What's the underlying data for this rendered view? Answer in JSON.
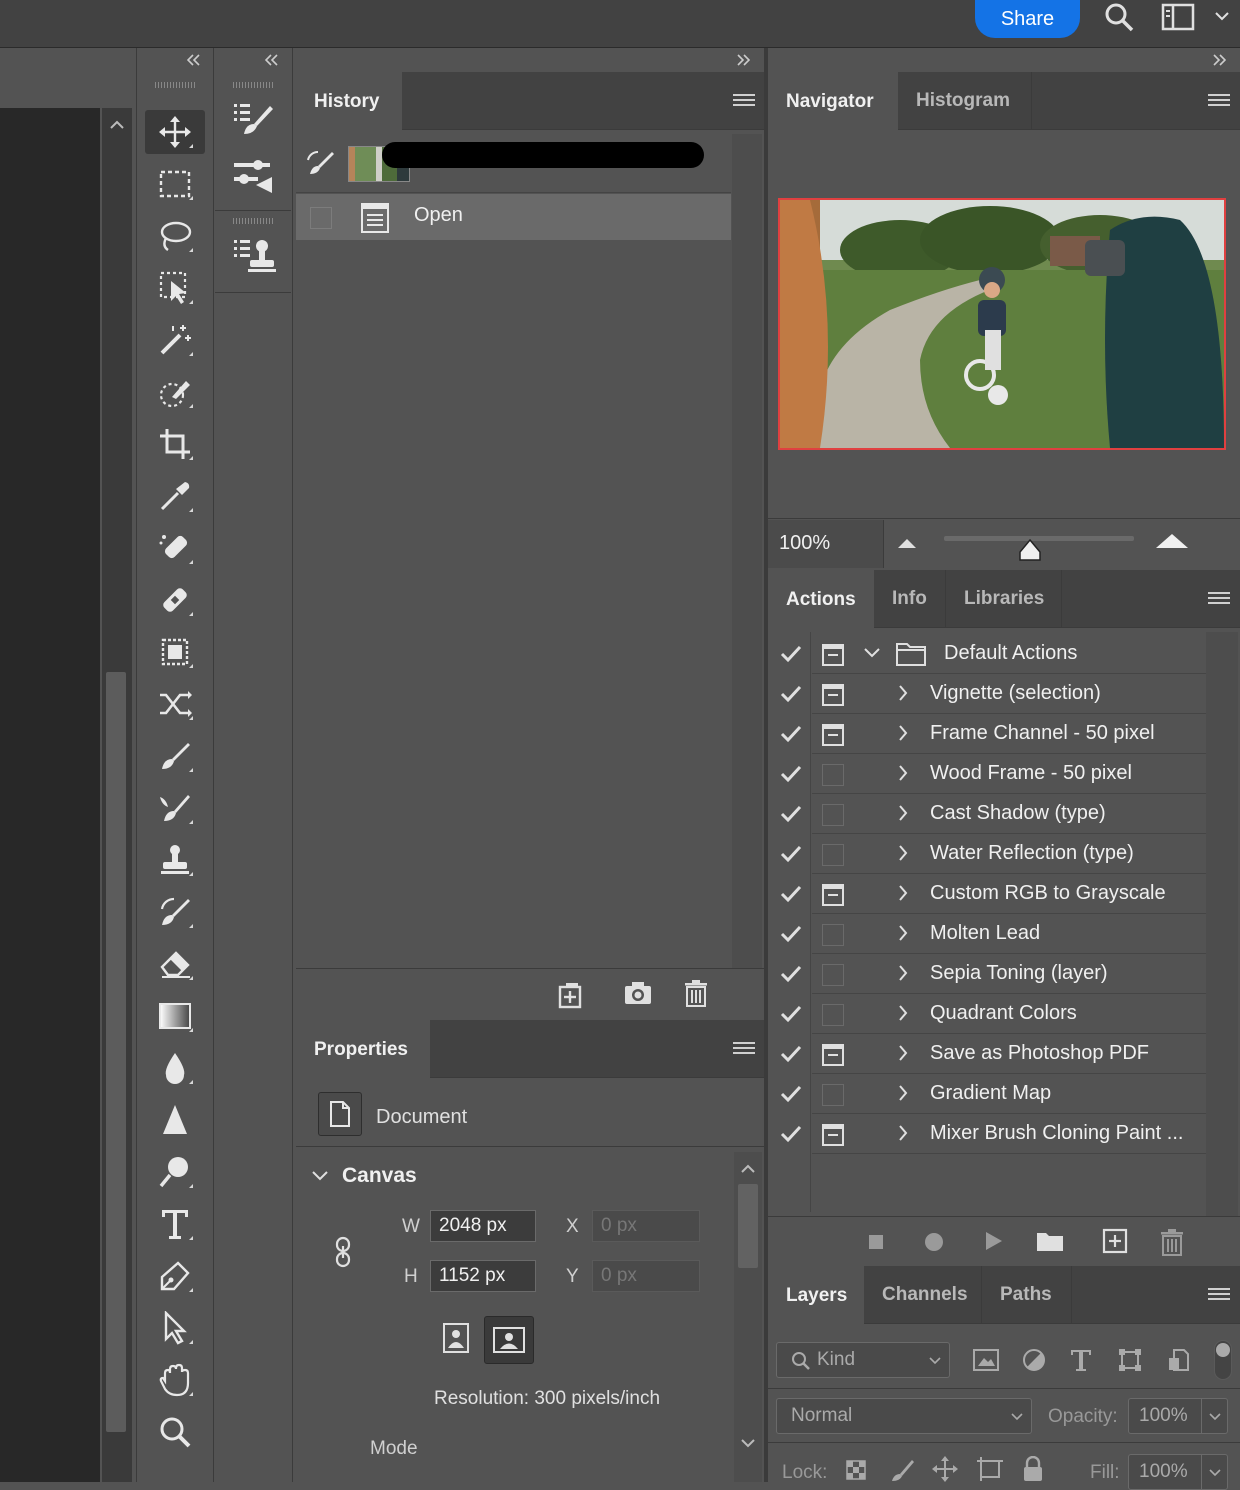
{
  "topbar": {
    "share_label": "Share",
    "icons": [
      "search-icon",
      "workspace-icon",
      "chevron-down-icon"
    ]
  },
  "history": {
    "tab_label": "History",
    "snapshot_name": "",
    "rows": [
      {
        "label": "Open"
      }
    ]
  },
  "properties": {
    "tab_label": "Properties",
    "document_label": "Document",
    "canvas_label": "Canvas",
    "w_label": "W",
    "h_label": "H",
    "x_label": "X",
    "y_label": "Y",
    "width_value": "2048 px",
    "height_value": "1152 px",
    "x_value": "0 px",
    "y_value": "0 px",
    "resolution": "Resolution: 300 pixels/inch",
    "mode_label": "Mode"
  },
  "navigator": {
    "tabs": [
      "Navigator",
      "Histogram"
    ],
    "zoom": "100%",
    "slider_level": 0.45
  },
  "actions": {
    "tabs": [
      "Actions",
      "Info",
      "Libraries"
    ],
    "items": [
      {
        "label": "Default Actions",
        "dialog": true,
        "folder": true
      },
      {
        "label": "Vignette (selection)",
        "dialog": true
      },
      {
        "label": "Frame Channel - 50 pixel",
        "dialog": true
      },
      {
        "label": "Wood Frame - 50 pixel",
        "dialog": false
      },
      {
        "label": "Cast Shadow (type)",
        "dialog": false
      },
      {
        "label": "Water Reflection (type)",
        "dialog": false
      },
      {
        "label": "Custom RGB to Grayscale",
        "dialog": true
      },
      {
        "label": "Molten Lead",
        "dialog": false
      },
      {
        "label": "Sepia Toning (layer)",
        "dialog": false
      },
      {
        "label": "Quadrant Colors",
        "dialog": false
      },
      {
        "label": "Save as Photoshop PDF",
        "dialog": true
      },
      {
        "label": "Gradient Map",
        "dialog": false
      },
      {
        "label": "Mixer Brush Cloning Paint ...",
        "dialog": true
      }
    ]
  },
  "layers": {
    "tabs": [
      "Layers",
      "Channels",
      "Paths"
    ],
    "filter_label": "Kind",
    "blend_mode": "Normal",
    "opacity_label": "Opacity:",
    "opacity_value": "100%",
    "lock_label": "Lock:",
    "fill_label": "Fill:",
    "fill_value": "100%"
  },
  "colors": {
    "accent": "#1473e6",
    "panel_bg": "#535353",
    "header_bg": "#424242",
    "canvas_bg": "#282828",
    "navigator_frame": "#e04040"
  }
}
